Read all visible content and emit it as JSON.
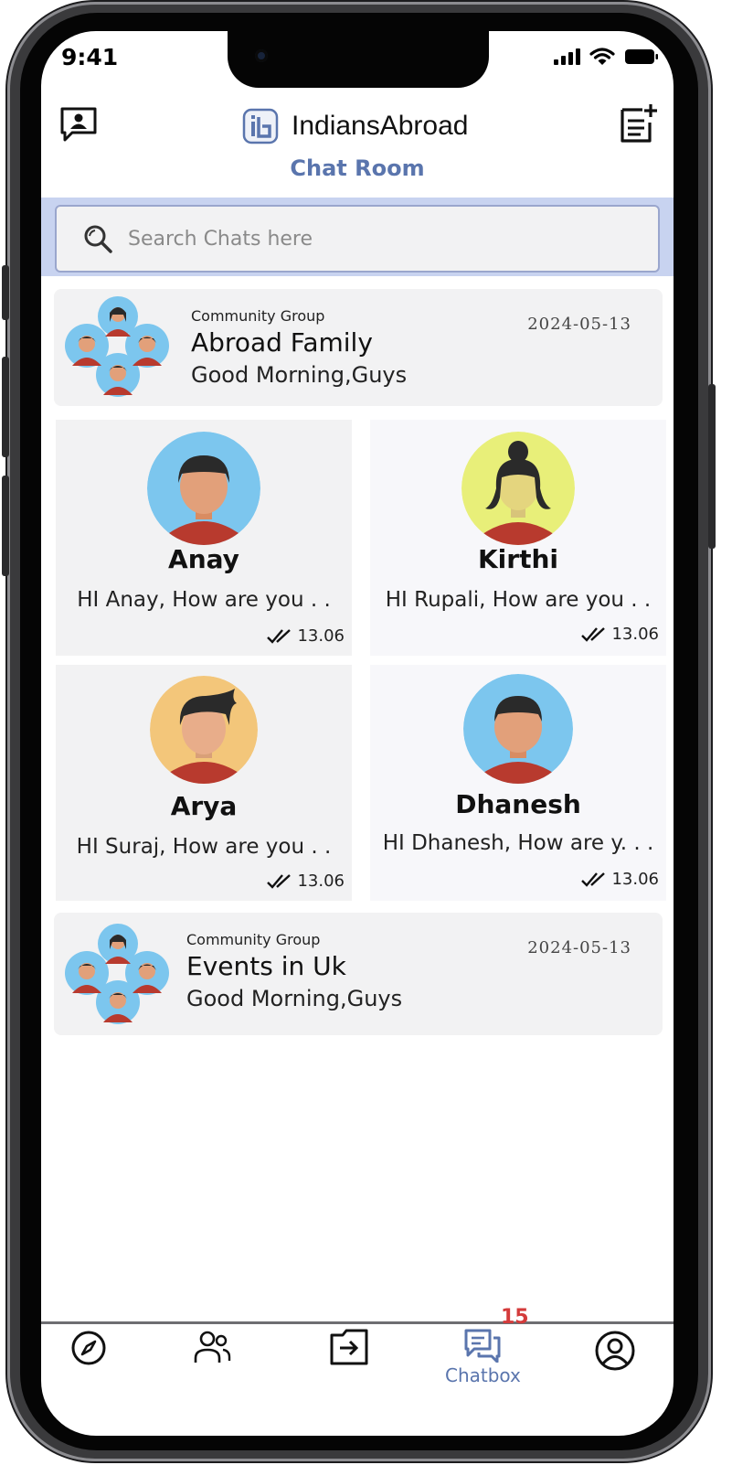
{
  "status_bar": {
    "time": "9:41"
  },
  "header": {
    "app_name": "IndiansAbroad",
    "subtitle": "Chat Room",
    "left_icon": "contact-card-icon",
    "right_icon": "note-add-icon"
  },
  "search": {
    "placeholder": "Search Chats here",
    "value": ""
  },
  "groups": [
    {
      "tag": "Community Group",
      "name": "Abroad Family",
      "message": "Good Morning,Guys",
      "date": "2024-05-13"
    },
    {
      "tag": "Community Group",
      "name": "Events in Uk",
      "message": "Good Morning,Guys",
      "date": "2024-05-13"
    }
  ],
  "contacts": [
    {
      "name": "Anay",
      "message": "HI Anay, How are you . .",
      "time": "13.06",
      "avatar_bg": "#7cc6ee"
    },
    {
      "name": "Kirthi",
      "message": "HI Rupali, How are you . .",
      "time": "13.06",
      "avatar_bg": "#e8ef79"
    },
    {
      "name": "Arya",
      "message": "HI Suraj, How are you . .",
      "time": "13.06",
      "avatar_bg": "#f3c67a"
    },
    {
      "name": "Dhanesh",
      "message": "HI Dhanesh, How are y. . .",
      "time": "13.06",
      "avatar_bg": "#7cc6ee"
    }
  ],
  "bottom_nav": {
    "items": [
      {
        "icon": "compass-icon",
        "label": ""
      },
      {
        "icon": "people-icon",
        "label": ""
      },
      {
        "icon": "import-icon",
        "label": ""
      },
      {
        "icon": "chat-icon",
        "label": "Chatbox",
        "badge": "15",
        "active": true
      },
      {
        "icon": "profile-icon",
        "label": ""
      }
    ]
  },
  "colors": {
    "accent": "#5a75ad",
    "search_band": "#c8d3f0",
    "card": "#f2f2f3",
    "badge": "#d43b3b"
  }
}
